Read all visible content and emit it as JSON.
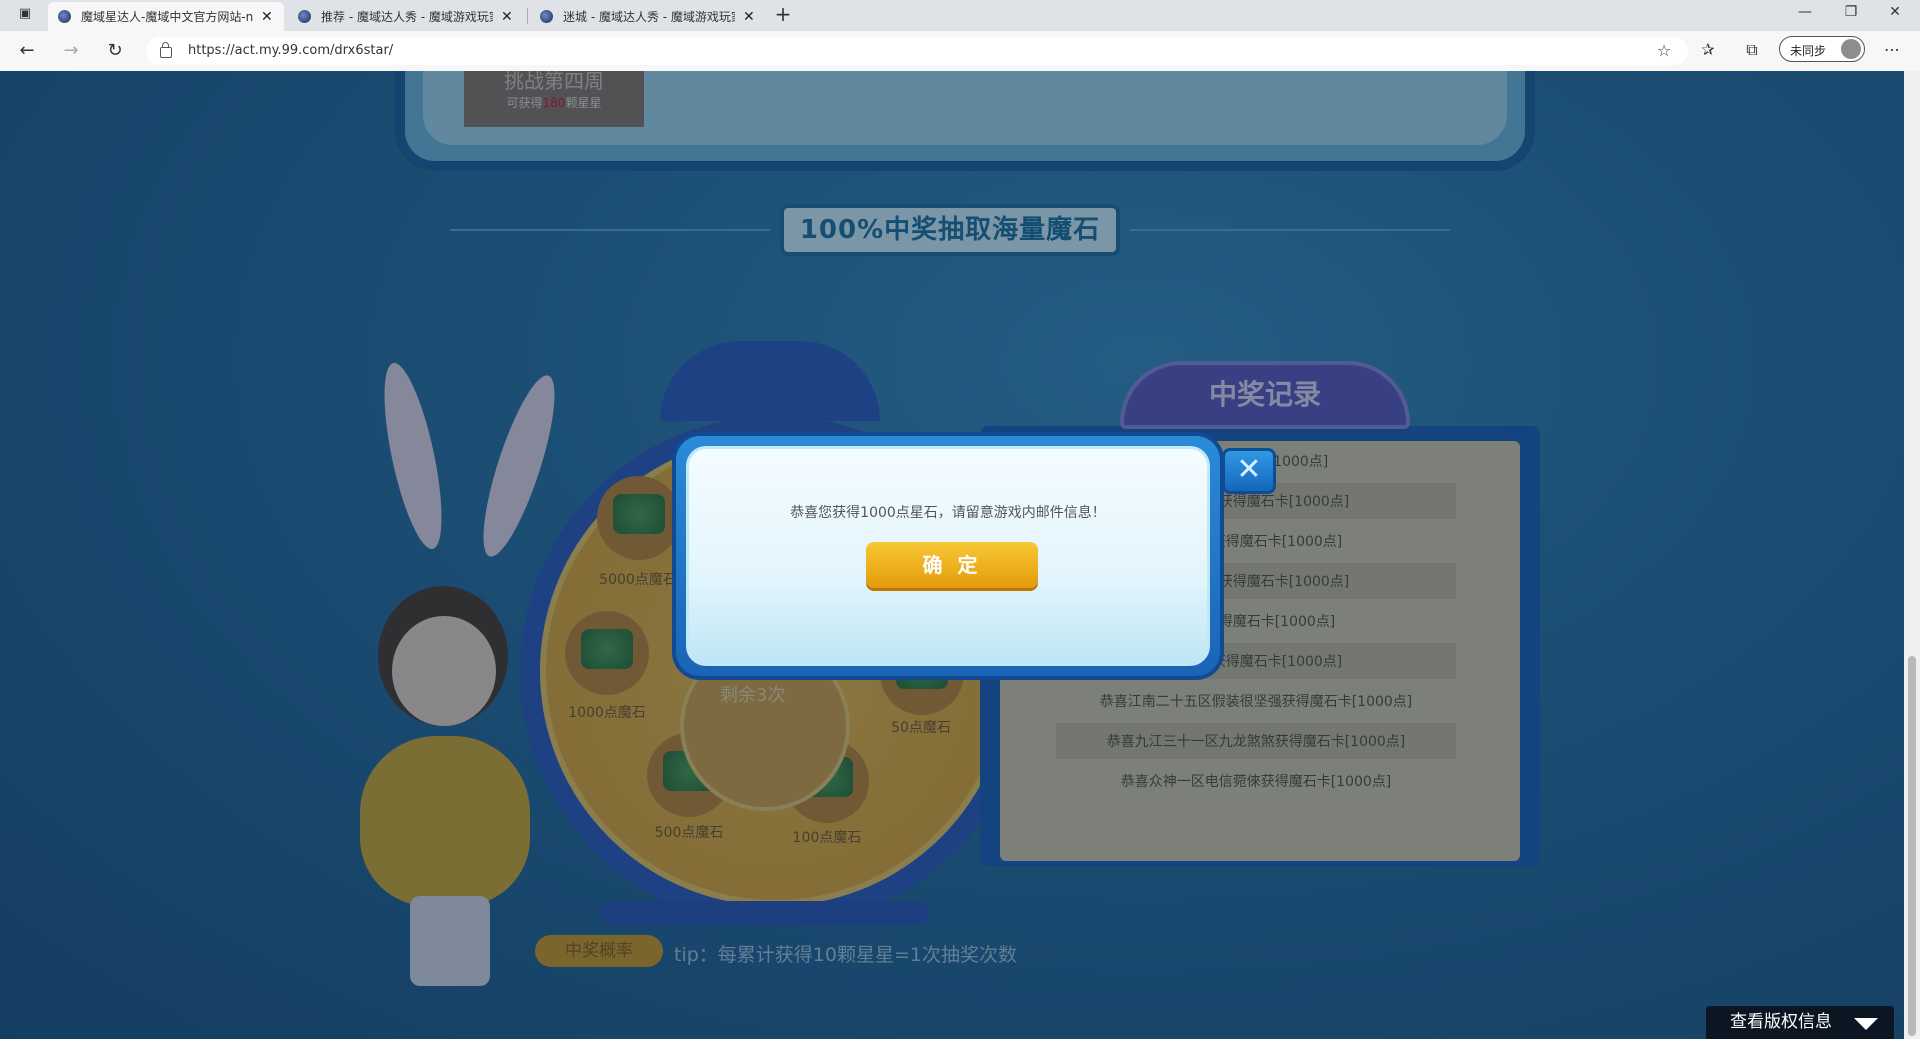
{
  "browser": {
    "tabs": [
      {
        "title": "魔域星达人-魔域中文官方网站-n"
      },
      {
        "title": "推荐 - 魔域达人秀 - 魔域游戏玩家"
      },
      {
        "title": "迷城 - 魔域达人秀 - 魔域游戏玩家"
      }
    ],
    "new_tab": "+",
    "url": "https://act.my.99.com/drx6star/",
    "sync_label": "未同步",
    "controls": {
      "minimize": "—",
      "restore": "❐",
      "close": "✕"
    }
  },
  "challenge": {
    "title": "挑战第四周",
    "reward_prefix": "可获得",
    "reward_value": "180",
    "reward_suffix": "颗星星"
  },
  "section_title": "100%中奖抽取海量魔石",
  "wheel": {
    "remaining": "剩余3次",
    "prizes": [
      {
        "label": "5000点魔石"
      },
      {
        "label": "1000点魔石"
      },
      {
        "label": "500点魔石"
      },
      {
        "label": "100点魔石"
      },
      {
        "label": "50点魔石"
      }
    ]
  },
  "records": {
    "title": "中奖记录",
    "rows": [
      "づ获得魔石卡[1000点]",
      "及妳好。获得魔石卡[1000点]",
      "お无情获得魔石卡[1000点]",
      "飞天小妞获得魔石卡[1000点]",
      "淡淡获得魔石卡[1000点]",
      "小呆ぃ获得魔石卡[1000点]",
      "恭喜江南二十五区假装很坚强获得魔石卡[1000点]",
      "恭喜九江三十一区九龙煞煞获得魔石卡[1000点]",
      "恭喜众神一区电信菀倈获得魔石卡[1000点]"
    ]
  },
  "bottom": {
    "probability_button": "中奖概率",
    "tip": "tip：每累计获得10颗星星=1次抽奖次数"
  },
  "copyright": "查看版权信息",
  "modal": {
    "message": "恭喜您获得1000点星石，请留意游戏内邮件信息！",
    "confirm": "确 定",
    "close": "✕"
  }
}
